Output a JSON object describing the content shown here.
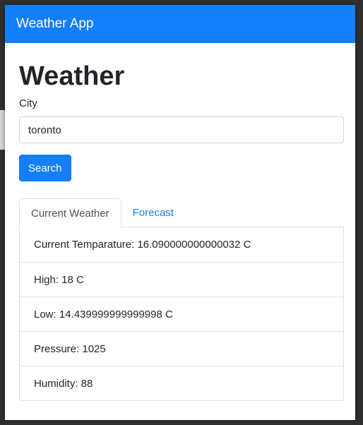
{
  "navbar": {
    "brand": "Weather App"
  },
  "main": {
    "title": "Weather",
    "city_label": "City",
    "city_value": "toronto",
    "search_label": "Search"
  },
  "tabs": [
    {
      "label": "Current Weather",
      "active": true
    },
    {
      "label": "Forecast",
      "active": false
    }
  ],
  "current_weather": [
    "Current Temparature: 16.090000000000032 C",
    "High: 18 C",
    "Low: 14.439999999999998 C",
    "Pressure: 1025",
    "Humidity: 88"
  ],
  "colors": {
    "primary": "#157efb",
    "text": "#212529",
    "border": "#dee2e6"
  }
}
